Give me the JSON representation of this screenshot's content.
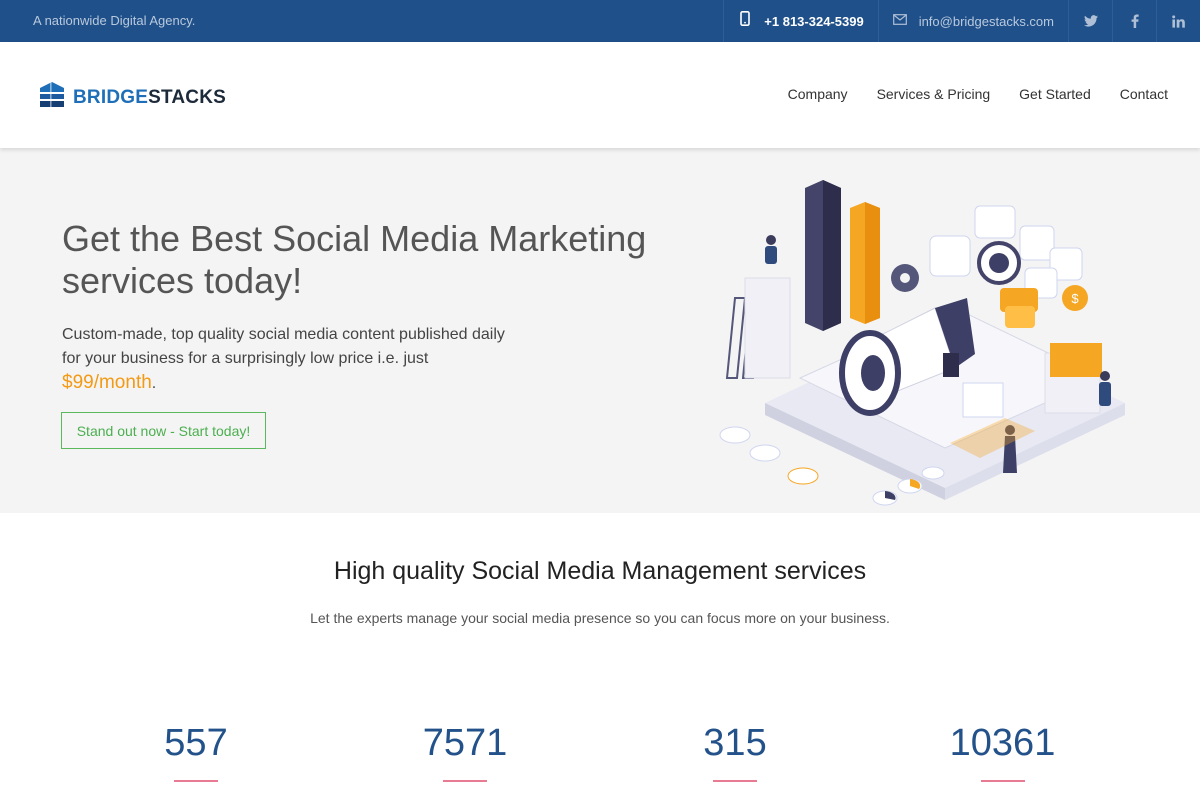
{
  "topbar": {
    "tagline": "A nationwide Digital Agency.",
    "phone": "+1 813-324-5399",
    "email": "info@bridgestacks.com",
    "social": [
      "twitter-icon",
      "facebook-icon",
      "linkedin-icon"
    ]
  },
  "brand": {
    "part1": "BRIDGE",
    "part2": "STACKS"
  },
  "nav": {
    "company": "Company",
    "services": "Services & Pricing",
    "get_started": "Get Started",
    "contact": "Contact"
  },
  "hero": {
    "title": "Get the Best Social Media Marketing services today!",
    "desc": "Custom-made, top quality social media content published daily for your business for a surprisingly low price i.e. just",
    "price": "$99/month",
    "period": ".",
    "cta": "Stand out now - Start today!"
  },
  "section": {
    "title": "High quality Social Media Management services",
    "subtitle": "Let the experts manage your social media presence so you can focus more on your business."
  },
  "stats": [
    "557",
    "7571",
    "315",
    "10361"
  ],
  "colors": {
    "topbar": "#1f5089",
    "accent_orange": "#f39a14",
    "cta_green": "#4caf50",
    "stat_blue": "#23528a",
    "stat_bar": "#e87a93"
  }
}
